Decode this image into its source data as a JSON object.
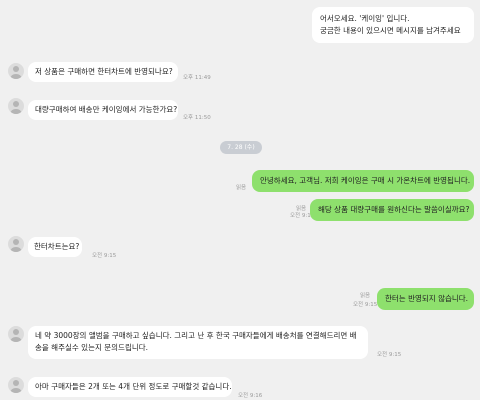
{
  "messages": [
    {
      "dir": "out",
      "lines": [
        "어서오세요. '케이잉' 입니다.",
        "궁금한 내용이 있으시면 메시지를 남겨주세요"
      ]
    },
    {
      "dir": "in",
      "text": "저 상품은 구매하면 한터차트에 반영되나요?",
      "time": "오후 11:49"
    },
    {
      "dir": "in",
      "text": "대량구매하여 배송만 케이잉에서 가능한가요?",
      "time": "오후 11:50"
    },
    {
      "dir": "out",
      "text": "안녕하세요, 고객님. 저희 케이잉은 구매 시 가온차트에 반영됩니다.",
      "read": "읽음"
    },
    {
      "dir": "out",
      "text": "해당 상품 대량구매를 원하신다는 말씀이실까요?",
      "read": "읽음",
      "time": "오전 9:12"
    },
    {
      "dir": "in",
      "text": "한터차트는요?",
      "time": "오전 9:15"
    },
    {
      "dir": "out",
      "text": "한터는 반영되지 않습니다.",
      "read": "읽음",
      "time": "오전 9:15"
    },
    {
      "dir": "in",
      "text": "네 약 3000장의 앨범을 구매하고 싶습니다. 그리고 난 후 한국 구매자들에게 배송처를 연결해드리면 배송을 해주실수 있는지 문의드립니다.",
      "time": "오전 9:15"
    },
    {
      "dir": "in",
      "text": "아마 구매자들은 2개 또는 4개 단위 정도로 구매할것 같습니다.",
      "time": "오전 9:16"
    }
  ],
  "date_divider": "7. 28 (수)",
  "colors": {
    "background": "#f0f0f0",
    "incoming": "#ffffff",
    "outgoing": "#8ee06d",
    "meta": "#9a9a9a"
  }
}
